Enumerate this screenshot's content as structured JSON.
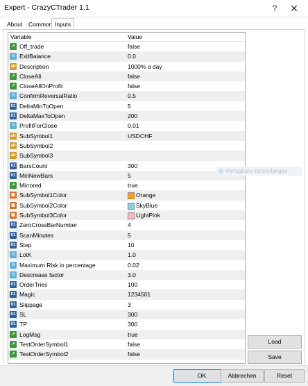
{
  "window": {
    "title": "Expert - CrazyCTrader 1.1",
    "help_label": "?",
    "close_label": "✕"
  },
  "tabs": [
    {
      "label": "About"
    },
    {
      "label": "Common"
    },
    {
      "label": "Inputs"
    }
  ],
  "grid": {
    "headers": {
      "variable": "Variable",
      "value": "Value"
    },
    "rows": [
      {
        "name": "Off_trade",
        "value": "false",
        "type": "bool"
      },
      {
        "name": "ExitBalance",
        "value": "0.0",
        "type": "double"
      },
      {
        "name": "Description",
        "value": "1000% a day",
        "type": "string"
      },
      {
        "name": "CloseAll",
        "value": "false",
        "type": "bool"
      },
      {
        "name": "CloseAllOnProfit",
        "value": "false",
        "type": "bool"
      },
      {
        "name": "ConfirmReversalRatio",
        "value": "0.5",
        "type": "double"
      },
      {
        "name": "DeltaMinToOpen",
        "value": "5",
        "type": "int"
      },
      {
        "name": "DeltaMaxToOpen",
        "value": "200",
        "type": "int"
      },
      {
        "name": "ProfitForClose",
        "value": "0.01",
        "type": "double"
      },
      {
        "name": "SubSymbol1",
        "value": "USDCHF",
        "type": "string"
      },
      {
        "name": "SubSymbol2",
        "value": "",
        "type": "string"
      },
      {
        "name": "SubSymbol3",
        "value": "",
        "type": "string"
      },
      {
        "name": "BarsCount",
        "value": "300",
        "type": "int"
      },
      {
        "name": "MinNewBars",
        "value": "5",
        "type": "int"
      },
      {
        "name": "Mirrored",
        "value": "true",
        "type": "bool"
      },
      {
        "name": "SubSymbol1Color",
        "value": "Orange",
        "type": "color",
        "color": "#ff9f00"
      },
      {
        "name": "SubSymbol2Color",
        "value": "SkyBlue",
        "type": "color",
        "color": "#87ceeb"
      },
      {
        "name": "SubSymbol3Color",
        "value": "LightPink",
        "type": "color",
        "color": "#ffb6c1"
      },
      {
        "name": "ZeroCrossBarNumber",
        "value": "4",
        "type": "int"
      },
      {
        "name": "ScanMinutes",
        "value": "5",
        "type": "int"
      },
      {
        "name": "Step",
        "value": "10",
        "type": "int"
      },
      {
        "name": "LotK",
        "value": "1.0",
        "type": "double"
      },
      {
        "name": "Maximum Risk in percentage",
        "value": "0.02",
        "type": "double"
      },
      {
        "name": "Descrease factor",
        "value": "3.0",
        "type": "double"
      },
      {
        "name": "OrderTries",
        "value": "100",
        "type": "int"
      },
      {
        "name": "Magic",
        "value": "1234501",
        "type": "int"
      },
      {
        "name": "Slippage",
        "value": "3",
        "type": "int"
      },
      {
        "name": "SL",
        "value": "300",
        "type": "int"
      },
      {
        "name": "TP",
        "value": "300",
        "type": "int"
      },
      {
        "name": "LogMsg",
        "value": "true",
        "type": "bool"
      },
      {
        "name": "TestOrderSymbol1",
        "value": "false",
        "type": "bool"
      },
      {
        "name": "TestOrderSymbol2",
        "value": "false",
        "type": "bool"
      }
    ]
  },
  "side_buttons": {
    "load": "Load",
    "save": "Save"
  },
  "footer_buttons": {
    "ok": "OK",
    "cancel": "Abbrechen",
    "reset": "Reset"
  },
  "ghost_hint": "Verfügbare Einstellungen",
  "icons": {
    "bool": "bool-icon",
    "double": "double-icon",
    "string": "string-icon",
    "int": "int-icon",
    "color": "color-icon"
  }
}
